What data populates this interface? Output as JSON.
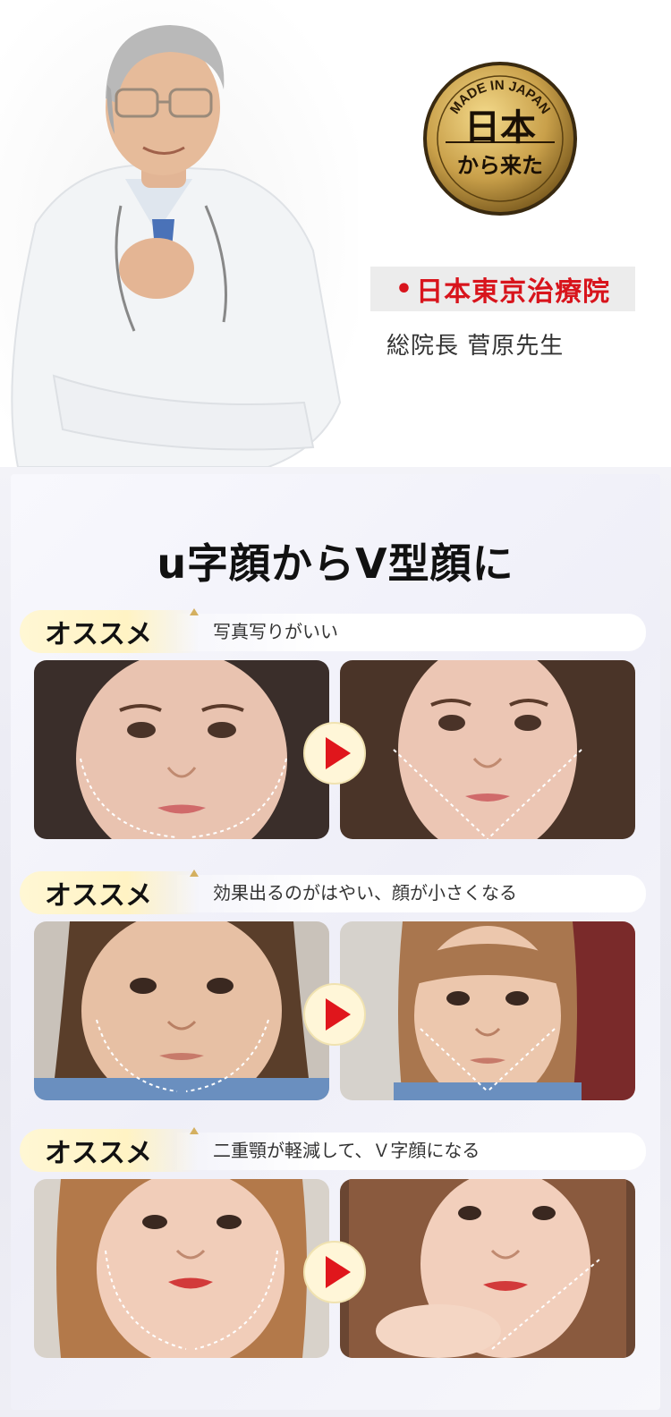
{
  "badge": {
    "top_text": "MADE IN JAPAN",
    "main_text": "日本",
    "bottom_text": "から来た"
  },
  "clinic": {
    "name": "日本東京治療院",
    "director": "総院長  菅原先生"
  },
  "heading": "u字顔からV型顔に",
  "sections": [
    {
      "tag": "オススメ",
      "description": "写真写りがいい"
    },
    {
      "tag": "オススメ",
      "description": "効果出るのがはやい、顔が小さくなる"
    },
    {
      "tag": "オススメ",
      "description": "二重顎が軽減して、Ｖ字顔になる"
    }
  ],
  "colors": {
    "accent_red": "#d8141c",
    "tag_yellow": "#fff3c4",
    "badge_gold": "#c9a04a"
  }
}
